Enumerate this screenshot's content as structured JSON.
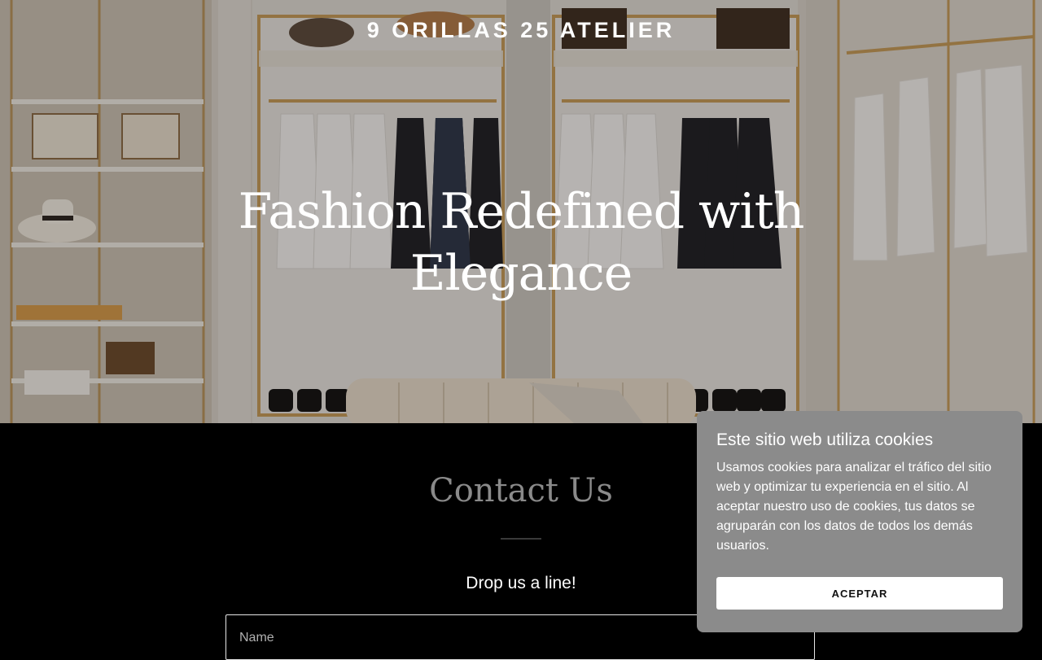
{
  "header": {
    "brand": "9 ORILLAS 25 ATELIER"
  },
  "hero": {
    "title": "Fashion Redefined with Elegance"
  },
  "contact": {
    "title": "Contact Us",
    "subtitle": "Drop us a line!",
    "name_placeholder": "Name"
  },
  "cookie_banner": {
    "title": "Este sitio web utiliza cookies",
    "text": "Usamos cookies para analizar el tráfico del sitio web y optimizar tu experiencia en el sitio. Al aceptar nuestro uso de cookies, tus datos se agruparán con los datos de todos los demás usuarios.",
    "accept_label": "ACEPTAR"
  }
}
